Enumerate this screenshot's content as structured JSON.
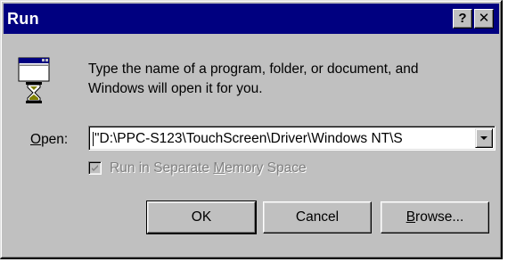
{
  "window": {
    "title": "Run",
    "help_glyph": "?",
    "close_glyph": "✕"
  },
  "icon": "run-program-icon",
  "prompt": {
    "line1": "Type the name of a program, folder, or document, and",
    "line2": "Windows will open it for you."
  },
  "open_field": {
    "label_mnemonic": "O",
    "label_rest": "pen:",
    "value": "\"D:\\PPC-S123\\TouchScreen\\Driver\\Windows NT\\S"
  },
  "separate_memory": {
    "label_before": "Run in Separate ",
    "label_mnemonic": "M",
    "label_after": "emory Space",
    "checked": true,
    "enabled": false
  },
  "buttons": {
    "ok": "OK",
    "cancel": "Cancel",
    "browse_mnemonic": "B",
    "browse_rest": "rowse..."
  },
  "colors": {
    "titlebar": "#000080",
    "face": "#c0c0c0",
    "disabled_text": "#808080"
  }
}
